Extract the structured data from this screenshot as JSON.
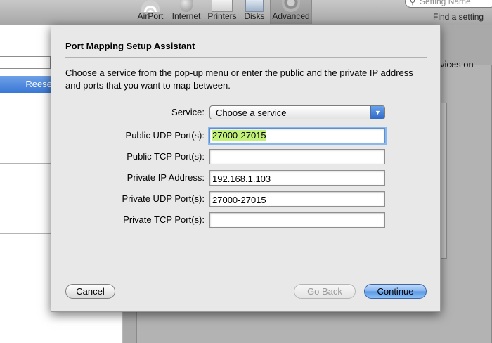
{
  "toolbar": {
    "items": [
      {
        "label": "AirPort",
        "icon": "airport-icon"
      },
      {
        "label": "Internet",
        "icon": "globe-icon"
      },
      {
        "label": "Printers",
        "icon": "printer-icon"
      },
      {
        "label": "Disks",
        "icon": "disk-icon"
      },
      {
        "label": "Advanced",
        "icon": "gear-icon"
      }
    ],
    "search_placeholder": "Setting Name",
    "find_label": "Find a setting"
  },
  "background": {
    "sidebar_selected": "Reese",
    "suffix_text": "vices on"
  },
  "dialog": {
    "title": "Port Mapping Setup Assistant",
    "description": "Choose a service from the pop-up menu or enter the public and the private IP address and ports that you want to map between.",
    "service_label": "Service:",
    "service_value": "Choose a service",
    "public_udp_label": "Public UDP Port(s):",
    "public_udp_value": "27000-27015",
    "public_tcp_label": "Public TCP Port(s):",
    "public_tcp_value": "",
    "private_ip_label": "Private IP Address:",
    "private_ip_value": "192.168.1.103",
    "private_udp_label": "Private UDP Port(s):",
    "private_udp_value": "27000-27015",
    "private_tcp_label": "Private TCP Port(s):",
    "private_tcp_value": "",
    "cancel_label": "Cancel",
    "back_label": "Go Back",
    "continue_label": "Continue"
  },
  "colors": {
    "accent": "#5a96e4",
    "selection_highlight": "#c2f27a"
  }
}
